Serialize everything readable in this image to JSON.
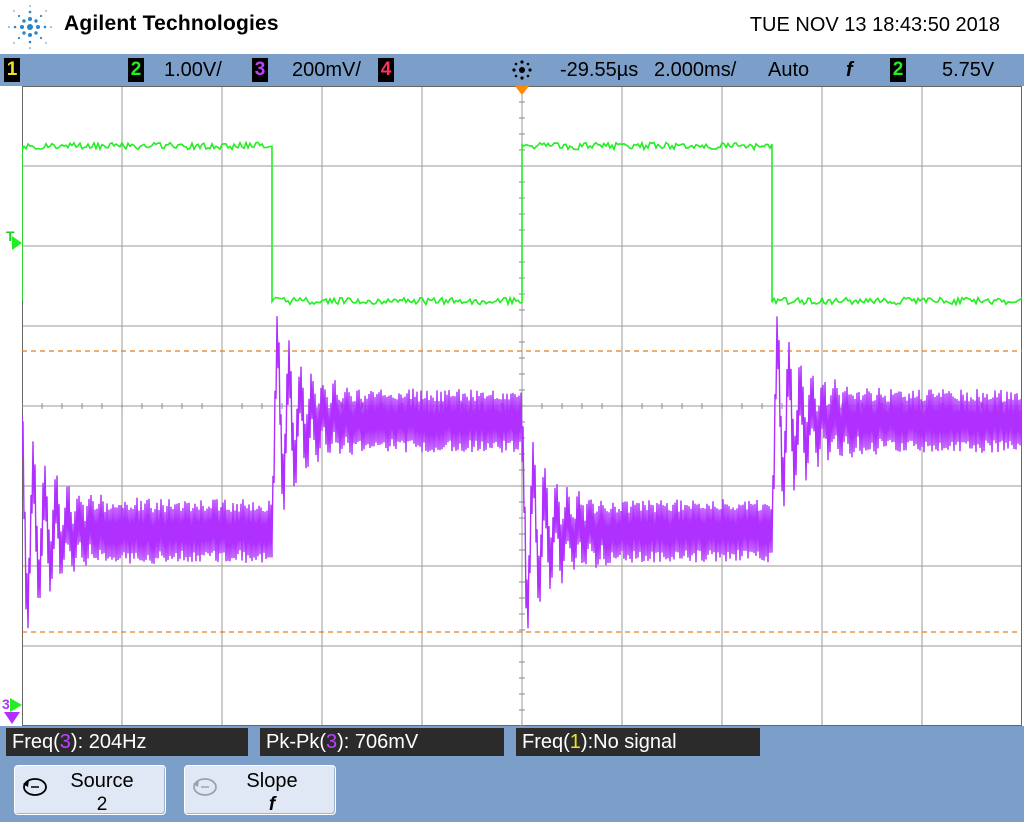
{
  "header": {
    "brand": "Agilent Technologies",
    "datetime": "TUE NOV 13 18:43:50 2018"
  },
  "status": {
    "ch1_label": "1",
    "ch2_label": "2",
    "ch2_scale": "1.00V/",
    "ch3_label": "3",
    "ch3_scale": "200mV/",
    "ch4_label": "4",
    "trigger_delay": "-29.55µs",
    "timebase": "2.000ms/",
    "trigger_mode": "Auto",
    "trigger_slope_symbol": "f",
    "trigger_source": "2",
    "trigger_level": "5.75V"
  },
  "colors": {
    "ch1": "#f0e020",
    "ch2": "#22ee22",
    "ch3": "#b030ff",
    "ch4": "#ff3060",
    "accent_bar": "#7b9fc9",
    "trigger_marker": "#ff8800"
  },
  "markers": {
    "trigger_level_marker": "T",
    "ch3_ground_marker": "3"
  },
  "measurements": [
    {
      "prefix": "Freq(",
      "channel": "3",
      "suffix": "): 204Hz"
    },
    {
      "prefix": "Pk-Pk(",
      "channel": "3",
      "suffix": "): 706mV"
    },
    {
      "prefix": "Freq(",
      "channel": "1",
      "suffix": "):No signal"
    }
  ],
  "softkeys": [
    {
      "label": "Source",
      "value": "2"
    },
    {
      "label": "Slope",
      "value": "f"
    }
  ]
}
